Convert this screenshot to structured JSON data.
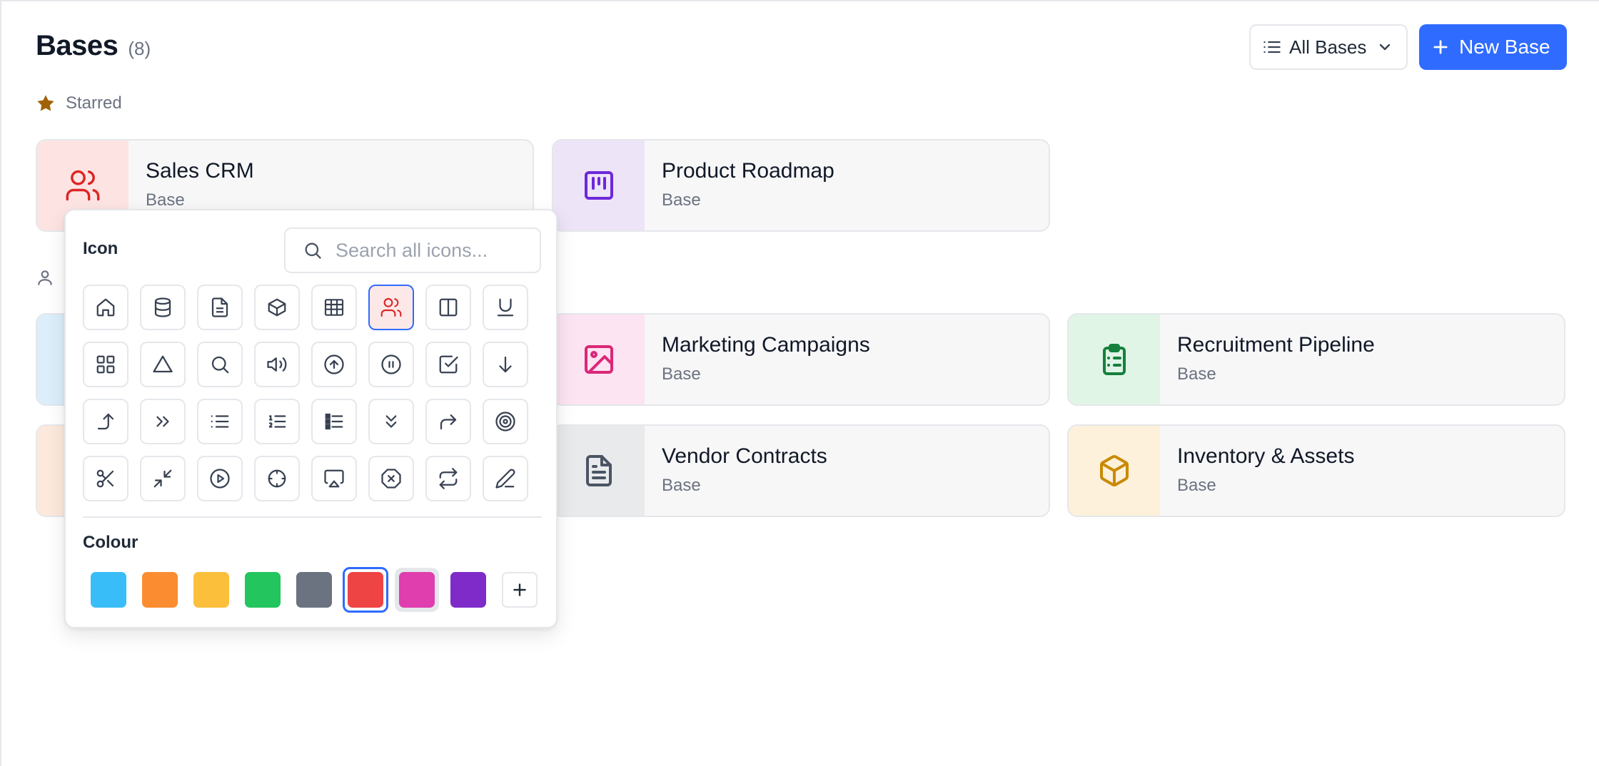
{
  "header": {
    "title": "Bases",
    "count": "(8)",
    "filter_label": "All Bases",
    "new_label": "New Base"
  },
  "sections": {
    "starred": "Starred"
  },
  "cards": [
    {
      "name": "Sales CRM",
      "type": "Base",
      "icon": "users-icon",
      "color": "#dc2626",
      "bg": "#fde4e2"
    },
    {
      "name": "Product Roadmap",
      "type": "Base",
      "icon": "kanban-icon",
      "color": "#6d28d9",
      "bg": "#ede4f8"
    },
    {
      "name": "Marketing Campaigns",
      "type": "Base",
      "icon": "image-icon",
      "color": "#db2777",
      "bg": "#fce4f3"
    },
    {
      "name": "Recruitment Pipeline",
      "type": "Base",
      "icon": "clipboard-list-icon",
      "color": "#15803d",
      "bg": "#e0f5e6"
    },
    {
      "name": "Vendor Contracts",
      "type": "Base",
      "icon": "file-text-icon",
      "color": "#4b5563",
      "bg": "#e9eaec"
    },
    {
      "name": "Inventory & Assets",
      "type": "Base",
      "icon": "box-icon",
      "color": "#ca8a04",
      "bg": "#fdf1dc"
    }
  ],
  "popover": {
    "icon_label": "Icon",
    "search_placeholder": "Search all icons...",
    "colour_label": "Colour",
    "selected_icon": "users-icon",
    "icons": [
      "home-icon",
      "database-icon",
      "file-text-icon",
      "box-icon",
      "table-icon",
      "users-icon",
      "columns-icon",
      "underline-icon",
      "grid-icon",
      "triangle-icon",
      "search-icon",
      "volume-icon",
      "arrow-up-circle-icon",
      "pause-circle-icon",
      "check-square-icon",
      "arrow-down-icon",
      "corner-right-up-icon",
      "chevrons-right-icon",
      "list-icon",
      "list-ordered-icon",
      "list-bullets-icon",
      "chevrons-down-icon",
      "redo-icon",
      "target-icon",
      "scissors-icon",
      "minimize-icon",
      "play-circle-icon",
      "crosshair-icon",
      "airplay-icon",
      "x-octagon-icon",
      "repeat-icon",
      "pen-icon"
    ],
    "colours": [
      "#38bdf8",
      "#fb8c2f",
      "#fbbf3c",
      "#22c55e",
      "#6b7280",
      "#ef4444",
      "#e03dae",
      "#7e2bc9"
    ],
    "selected_colour": "#ef4444",
    "hovered_colour": "#e03dae"
  }
}
